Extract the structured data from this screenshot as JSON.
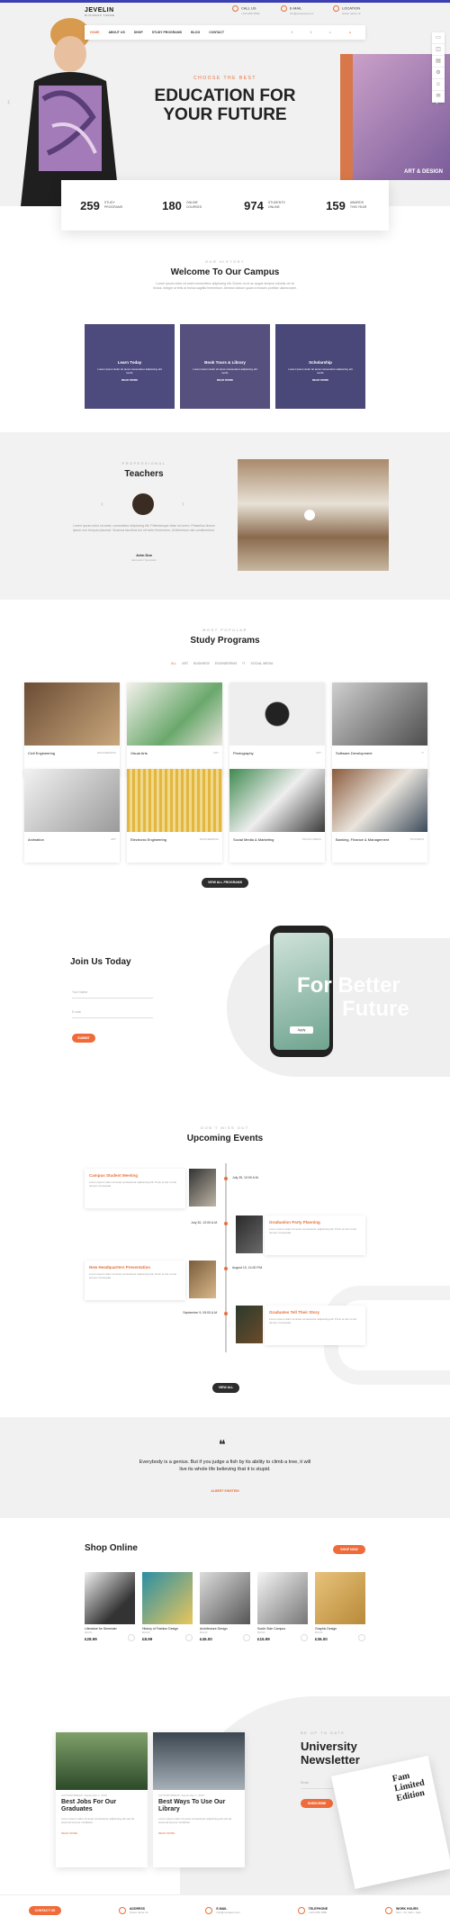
{
  "header": {
    "logo_name": "JEVELIN",
    "logo_sub": "BUSINESS THEME",
    "contacts": [
      {
        "title": "CALL US",
        "value": "+123-456-7890"
      },
      {
        "title": "E-MAIL",
        "value": "info@company.com"
      },
      {
        "title": "LOCATION",
        "value": "Street name 12"
      }
    ],
    "nav": [
      "HOME",
      "ABOUT US",
      "SHOP",
      "STUDY PROGRAMS",
      "BLOG",
      "CONTACT"
    ]
  },
  "hero": {
    "kicker": "CHOOSE THE BEST",
    "title_line1": "EDUCATION FOR",
    "title_line2": "YOUR FUTURE",
    "book_text": "ART & DESIGN",
    "stats": [
      {
        "number": "259",
        "label": "STUDY PROGRAMS"
      },
      {
        "number": "180",
        "label": "ONLINE COURSES"
      },
      {
        "number": "974",
        "label": "STUDENTS ONLINE"
      },
      {
        "number": "159",
        "label": "AWARDS THIS YEAR"
      }
    ]
  },
  "welcome": {
    "kicker": "OUR HISTORY",
    "title": "Welcome To Our Campus",
    "text": "Lorem ipsum dolor sit amet consectetur adipiscing elit. Donec ut mi ac augue tempus lobortis vel at lectus. Integer ut felis at lectus sagittis fermentum. Aenean dictum quam id mauris porttitor ullamcorper.",
    "tiles": [
      {
        "title": "Learn Today",
        "text": "Lorem ipsum dolor sit amet consectetur adipiscing elit morbi.",
        "more": "READ MORE"
      },
      {
        "title": "Book Tours & Library",
        "text": "Lorem ipsum dolor sit amet consectetur adipiscing elit morbi.",
        "more": "READ MORE"
      },
      {
        "title": "Scholarship",
        "text": "Lorem ipsum dolor sit amet consectetur adipiscing elit morbi.",
        "more": "READ MORE"
      }
    ]
  },
  "teachers": {
    "kicker": "PROFESSIONAL",
    "title": "Teachers",
    "text": "Lorem ipsum dolor sit amet, consectetur adipiscing elit. Pellentesque vitae mi lorem. Phasellus dictum ipsum non tempus placerat. Vivamus faucibus leo vel ante fermentum, id bibendum nisl condimentum.",
    "name": "John Doe",
    "role": "Education Specialist"
  },
  "programs": {
    "kicker": "MOST POPULAR",
    "title": "Study Programs",
    "tabs": [
      "ALL",
      "ART",
      "BUSINESS",
      "ENGINEERING",
      "IT",
      "SOCIAL MEDIA"
    ],
    "items": [
      {
        "name": "Civil Engineering",
        "tag": "ENGINEERING"
      },
      {
        "name": "Visual Arts",
        "tag": "ART"
      },
      {
        "name": "Photography",
        "tag": "ART"
      },
      {
        "name": "Software Development",
        "tag": "IT"
      },
      {
        "name": "Animation",
        "tag": "ART"
      },
      {
        "name": "Electronic Engineering",
        "tag": "ENGINEERING"
      },
      {
        "name": "Social Media & Marketing",
        "tag": "SOCIAL MEDIA"
      },
      {
        "name": "Banking, Finance & Management",
        "tag": "BUSINESS"
      }
    ],
    "button": "VIEW ALL PROGRAMS"
  },
  "join": {
    "title": "Join Us Today",
    "name_placeholder": "Your Name",
    "email_placeholder": "E-mail",
    "button": "SUBMIT",
    "future_line1": "For Better",
    "future_line2": "Future",
    "phone_button": "Apply"
  },
  "events": {
    "kicker": "DON'T MISS OUT",
    "title": "Upcoming Events",
    "items": [
      {
        "title": "Campus Student Meeting",
        "date": "July 25, 10:00 A.M.",
        "text": "Lorem ipsum dolor sit amet consectetur adipiscing elit. Proin et dui ut nisl tempor consequat."
      },
      {
        "title": "Graduation Party Planning",
        "date": "July 30, 12:00 A.M.",
        "text": "Lorem ipsum dolor sit amet consectetur adipiscing elit. Proin et dui ut nisl tempor consequat."
      },
      {
        "title": "New Headquarters Presentation",
        "date": "August 10, 14:00 P.M.",
        "text": "Lorem ipsum dolor sit amet consectetur adipiscing elit. Proin et dui ut nisl tempor consequat."
      },
      {
        "title": "Graduates Tell Their Story",
        "date": "September 9, 09:00 A.M.",
        "text": "Lorem ipsum dolor sit amet consectetur adipiscing elit. Proin et dui ut nisl tempor consequat."
      }
    ],
    "button": "VIEW ALL"
  },
  "quote": {
    "text": "Everybody is a genius. But if you judge a fish by its ability to climb a tree, it will live its whole life believing that it is stupid.",
    "author": "ALBERT EINSTEIN"
  },
  "shop": {
    "title": "Shop Online",
    "button": "SHOP NOW",
    "products": [
      {
        "name": "Literature for Semester",
        "author": "BOOK",
        "price": "£28.99"
      },
      {
        "name": "History of Fashion Design",
        "author": "BOOK",
        "price": "£8.99"
      },
      {
        "name": "Architecture Design",
        "author": "BOOK",
        "price": "£45.00"
      },
      {
        "name": "South Side Campus",
        "author": "BOOK",
        "price": "£15.99"
      },
      {
        "name": "Graphic Design",
        "author": "BOOK",
        "price": "£36.00"
      }
    ]
  },
  "blog": {
    "posts": [
      {
        "meta": "AUTUMN BREAK, September 1, 2019",
        "title": "Best Jobs For Our Graduates",
        "text": "Lorem ipsum dolor sit amet consectetur adipiscing elit sed do eiusmod tempor incididunt.",
        "more": "READ MORE"
      },
      {
        "meta": "AUTUMN BREAK, September 1, 2019",
        "title": "Best Ways To Use Our Library",
        "text": "Lorem ipsum dolor sit amet consectetur adipiscing elit sed do eiusmod tempor incididunt.",
        "more": "READ MORE"
      }
    ],
    "kicker": "BE UP TO DATE",
    "title_line1": "University",
    "title_line2": "Newsletter",
    "email_placeholder": "Email",
    "button": "SUBSCRIBE",
    "mag_text": "Fam Limited Edition"
  },
  "footer": {
    "button": "CONTACT US",
    "items": [
      {
        "title": "ADDRESS",
        "value": "Street name 12"
      },
      {
        "title": "E-MAIL",
        "value": "info@company.com"
      },
      {
        "title": "TELEPHONE",
        "value": "+123-456-7890"
      },
      {
        "title": "WORK HOURS",
        "value": "Mon - Fri, 9am - 6pm"
      }
    ]
  }
}
